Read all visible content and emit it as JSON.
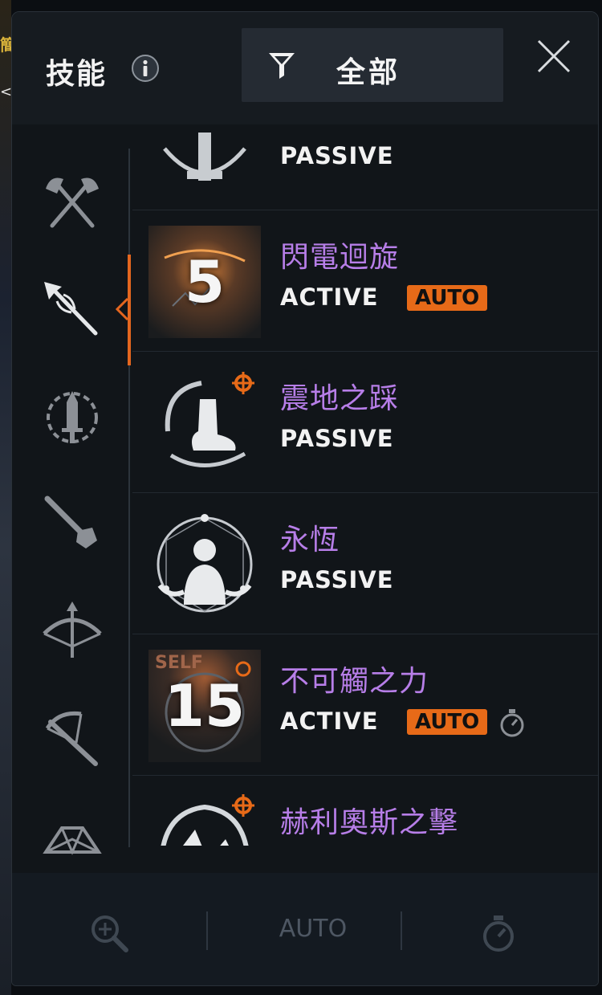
{
  "background": {
    "left_glyph": "簡",
    "left_chevron": "<"
  },
  "header": {
    "title": "技能",
    "info_icon": "info-icon",
    "filter": {
      "icon": "funnel-icon",
      "label": "全部"
    },
    "close_icon": "close-icon"
  },
  "categories": [
    {
      "icon": "crossed-axes-icon",
      "active": false
    },
    {
      "icon": "spear-icon",
      "active": true
    },
    {
      "icon": "dagger-wreath-icon",
      "active": false
    },
    {
      "icon": "sword-staff-icon",
      "active": false
    },
    {
      "icon": "bow-icon",
      "active": false
    },
    {
      "icon": "crossbow-icon",
      "active": false
    },
    {
      "icon": "orb-icon",
      "active": false
    }
  ],
  "skills": [
    {
      "name": "",
      "type": "PASSIVE",
      "icon": "partial-skill-icon"
    },
    {
      "name": "閃電迴旋",
      "type": "ACTIVE",
      "badge": "AUTO",
      "count": "5",
      "icon": "lightning-spin-icon"
    },
    {
      "name": "震地之踩",
      "type": "PASSIVE",
      "icon": "ground-stomp-icon"
    },
    {
      "name": "永恆",
      "type": "PASSIVE",
      "icon": "eternity-icon"
    },
    {
      "name": "不可觸之力",
      "type": "ACTIVE",
      "badge": "AUTO",
      "count": "15",
      "self_tag": "SELF",
      "timer_icon": "stopwatch-icon",
      "icon": "untouchable-force-icon"
    },
    {
      "name": "赫利奧斯之擊",
      "type": "",
      "icon": "helios-strike-icon"
    }
  ],
  "bottom_bar": {
    "zoom_icon": "zoom-in-icon",
    "auto_label": "AUTO",
    "timer_icon": "stopwatch-icon"
  },
  "colors": {
    "accent": "#e76a18",
    "skill_name": "#b77ee8",
    "panel": "#111519",
    "header": "#161b20"
  }
}
